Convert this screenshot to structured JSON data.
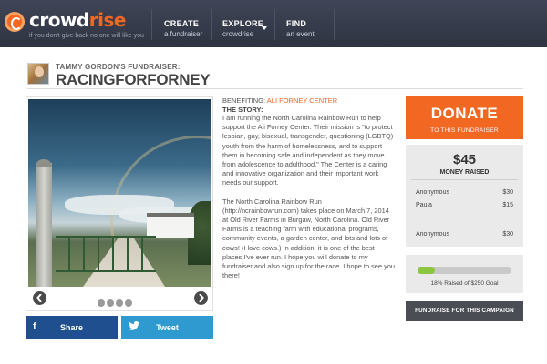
{
  "header": {
    "logo_prefix": "crowd",
    "logo_accent": "rise",
    "tagline": "if you don't give back no one will like you",
    "nav": [
      {
        "line1": "CREATE",
        "line2": "a fundraiser"
      },
      {
        "line1": "EXPLORE",
        "line2": "crowdrise"
      },
      {
        "line1": "FIND",
        "line2": "an event"
      }
    ]
  },
  "fundraiser": {
    "owner_label": "TAMMY GORDON'S FUNDRAISER:",
    "title": "RACINGFORFORNEY"
  },
  "slider": {
    "prev_icon": "chevron-left-icon",
    "next_icon": "chevron-right-icon",
    "dot_count": 4
  },
  "share": {
    "facebook_icon": "f",
    "facebook_label": "Share",
    "twitter_label": "Tweet"
  },
  "story": {
    "beneficiary_label": "BENEFITING:",
    "beneficiary_name": "ALI FORNEY CENTER",
    "heading": "THE STORY:",
    "paragraph1": "I am running the North Carolina Rainbow Run to help support the Ali Forney Center. Their mission is \"to protect lesbian, gay, bisexual, transgender, questioning (LGBTQ) youth from the harm of homelessness, and to support them in becoming safe and independent as they move from adolescence to adulthood.\" The Center is a caring and innovative organization and their important work needs our support.",
    "paragraph2": "The North Carolina Rainbow Run (http://ncrainbowrun.com) takes place on March 7, 2014 at Old River Farms in Burgaw, North Carolina. Old River Farms is a teaching farm with educational programs, community events, a garden center, and lots and lots of cows! (I love cows.) In addition, it is one of the best places I've ever run. I hope you will donate to my fundraiser and also sign up for the race. I hope to see you there!"
  },
  "donate": {
    "label": "DONATE",
    "sublabel": "TO THIS FUNDRAISER"
  },
  "raised": {
    "amount": "$45",
    "label": "MONEY RAISED",
    "donors": [
      {
        "name": "Anonymous",
        "amount": "$30"
      },
      {
        "name": "Paula",
        "amount": "$15"
      },
      {
        "name": "Anonymous",
        "amount": "$30"
      }
    ]
  },
  "goal": {
    "progress_percent": 18,
    "text": "18% Raised of $250 Goal"
  },
  "campaign_button": "FUNDRAISE FOR THIS CAMPAIGN",
  "colors": {
    "header_bg": "#373c4b",
    "accent_orange": "#f26722",
    "facebook_blue": "#1f4f8f",
    "twitter_blue": "#2e9ad0",
    "progress_green": "#8cc63f"
  }
}
